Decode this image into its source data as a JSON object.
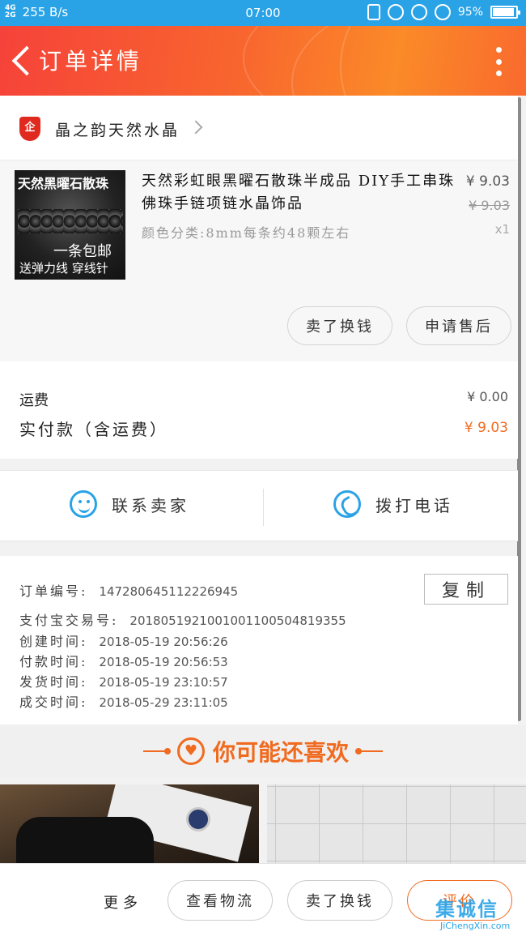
{
  "status_bar": {
    "signal_top": "4G",
    "signal_bottom": "2G",
    "speed": "255 B/s",
    "time": "07:00",
    "battery": "95%"
  },
  "header": {
    "title": "订单详情"
  },
  "shop": {
    "badge": "企",
    "name": "晶之韵天然水晶"
  },
  "product": {
    "image_text_top": "天然黑曜石散珠",
    "image_text_mid": "一条包邮",
    "image_text_bottom": "送弹力线 穿线针",
    "title": "天然彩虹眼黑曜石散珠半成品 DIY手工串珠佛珠手链项链水晶饰品",
    "spec": "颜色分类:8mm每条约48颗左右",
    "price": "¥ 9.03",
    "original_price": "¥ 9.03",
    "quantity": "x1",
    "btn_sell": "卖了换钱",
    "btn_aftersale": "申请售后"
  },
  "fees": {
    "shipping_label": "运费",
    "shipping_value": "¥ 0.00",
    "paid_label": "实付款（含运费）",
    "paid_value": "¥ 9.03"
  },
  "contact": {
    "seller_label": "联系卖家",
    "call_label": "拨打电话"
  },
  "order_info": {
    "copy_label": "复制",
    "rows": [
      {
        "k": "订单编号:",
        "v": "147280645112226945"
      },
      {
        "k": "支付宝交易号:",
        "v": "2018051921001001100504819355"
      },
      {
        "k": "创建时间:",
        "v": "2018-05-19 20:56:26"
      },
      {
        "k": "付款时间:",
        "v": "2018-05-19 20:56:53"
      },
      {
        "k": "发货时间:",
        "v": "2018-05-19 23:10:57"
      },
      {
        "k": "成交时间:",
        "v": "2018-05-29 23:11:05"
      }
    ]
  },
  "recommend": {
    "title": "你可能还喜欢"
  },
  "bottom_bar": {
    "more": "更多",
    "logistics": "查看物流",
    "sell": "卖了换钱",
    "review": "评价"
  },
  "watermark": {
    "logo": "集诚信",
    "url": "JiChengXin.com"
  },
  "colors": {
    "status_bar": "#2aa3e6",
    "header_start": "#f6423a",
    "header_end": "#fb8a28",
    "accent_orange": "#f06a20",
    "icon_blue": "#2aa3e6"
  }
}
